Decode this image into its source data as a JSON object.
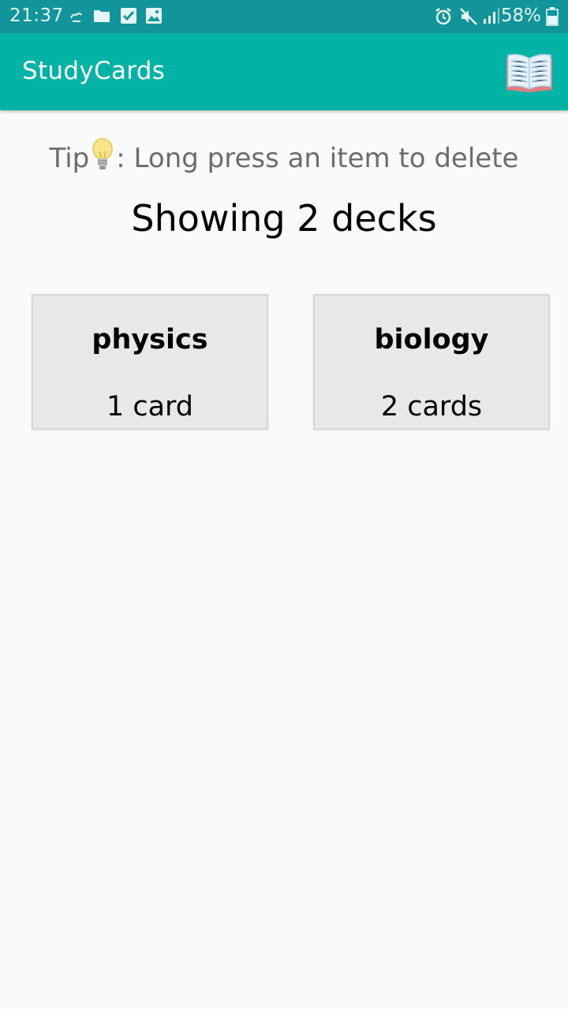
{
  "status_bar": {
    "time": "21:37",
    "battery": "58%",
    "icons": [
      "cloud-icon",
      "folder-icon",
      "checkbox-icon",
      "image-icon",
      "alarm-icon",
      "mute-icon",
      "signal-icon",
      "battery-icon"
    ]
  },
  "app_bar": {
    "title": "StudyCards",
    "icon": "book-icon"
  },
  "tip": {
    "prefix": "Tip",
    "icon": "lightbulb-icon",
    "text": ": Long press an item to delete"
  },
  "deck_count": "Showing 2 decks",
  "decks": [
    {
      "name": "physics",
      "cards": "1 card"
    },
    {
      "name": "biology",
      "cards": "2 cards"
    }
  ],
  "colors": {
    "status_bar": "#12959a",
    "app_bar": "#00b3a4",
    "background": "#fafafa",
    "card": "#e8e8e8"
  }
}
